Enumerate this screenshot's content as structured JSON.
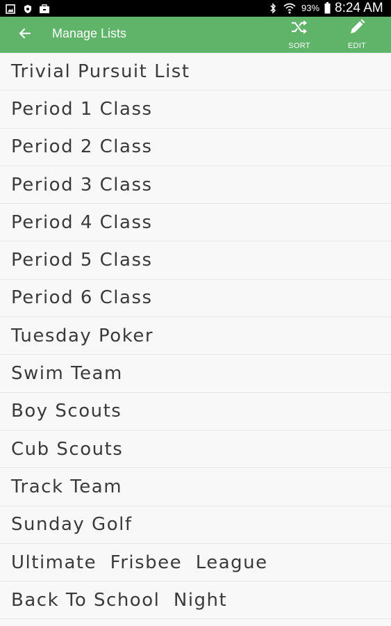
{
  "status_bar": {
    "battery_percent": "93%",
    "time": "8:24 AM",
    "left_icons": [
      "gallery-icon",
      "shield-icon",
      "briefcase-icon"
    ],
    "right_icons": [
      "bluetooth-icon",
      "wifi-icon",
      "battery-icon"
    ]
  },
  "app_bar": {
    "back_icon": "arrow-left-icon",
    "title": "Manage Lists",
    "actions": [
      {
        "icon": "shuffle-icon",
        "label": "SORT"
      },
      {
        "icon": "pencil-icon",
        "label": "EDIT"
      }
    ],
    "color": "#5fb46a"
  },
  "lists": [
    {
      "name": "Trivial Pursuit List"
    },
    {
      "name": "Period 1 Class"
    },
    {
      "name": "Period 2 Class"
    },
    {
      "name": "Period 3 Class"
    },
    {
      "name": "Period 4 Class"
    },
    {
      "name": "Period 5 Class"
    },
    {
      "name": "Period 6 Class"
    },
    {
      "name": "Tuesday Poker"
    },
    {
      "name": "Swim Team"
    },
    {
      "name": "Boy Scouts"
    },
    {
      "name": "Cub Scouts"
    },
    {
      "name": "Track Team"
    },
    {
      "name": "Sunday Golf"
    },
    {
      "name": "Ultimate  Frisbee  League"
    },
    {
      "name": "Back To School  Night"
    }
  ]
}
